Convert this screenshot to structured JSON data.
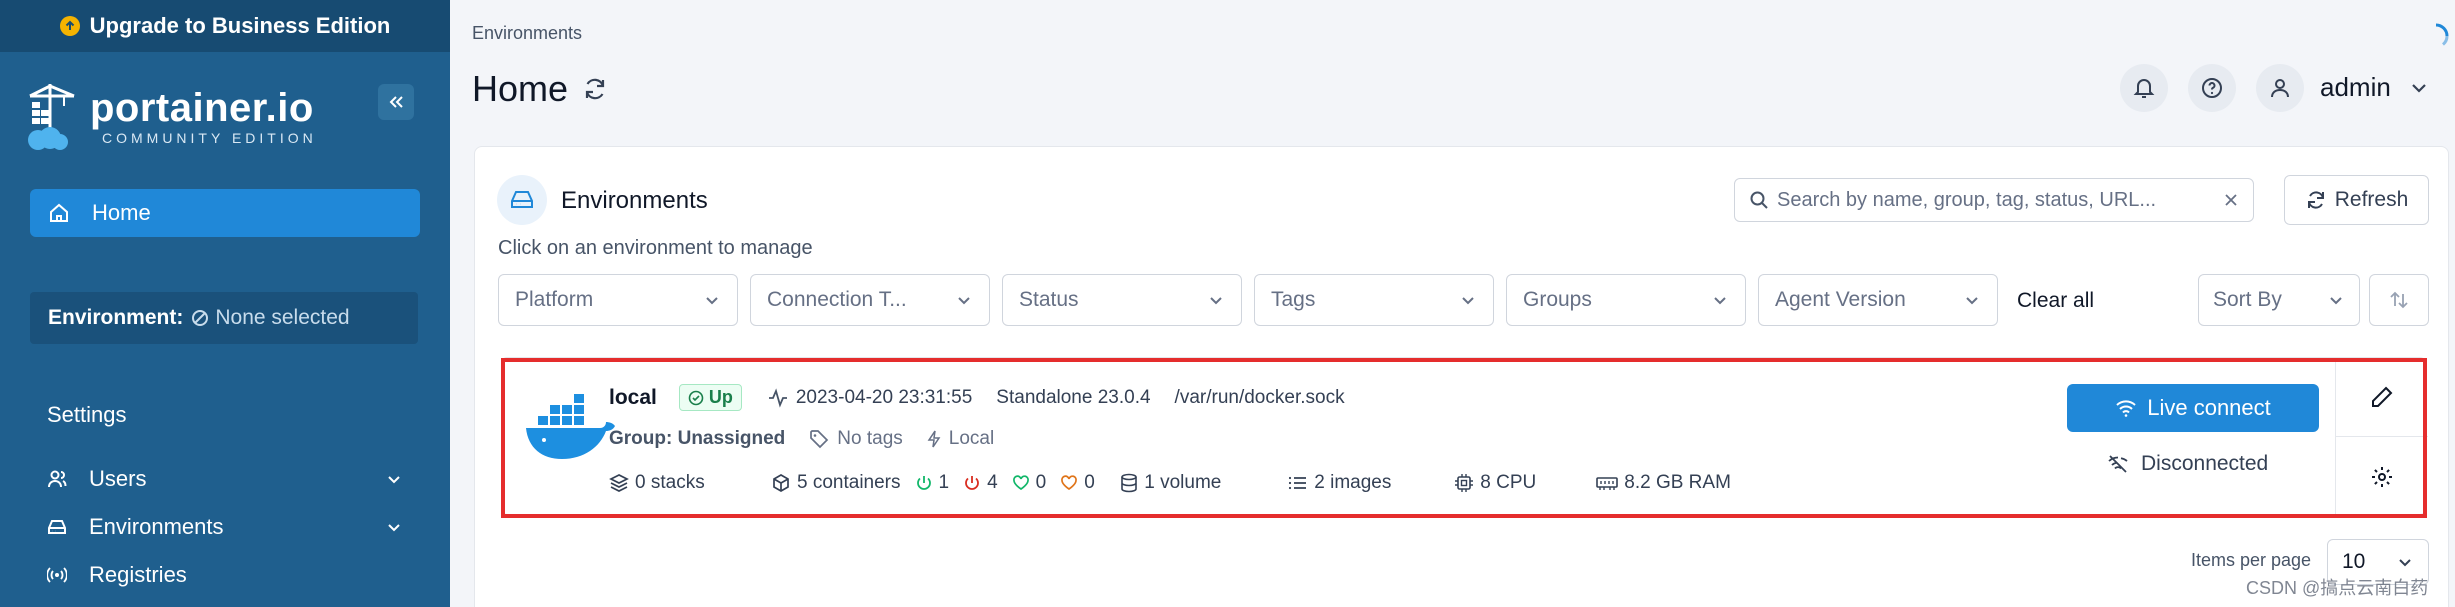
{
  "sidebar": {
    "upgrade_label": "Upgrade to Business Edition",
    "brand": "portainer.io",
    "edition": "COMMUNITY EDITION",
    "nav_home": "Home",
    "environment_label": "Environment:",
    "environment_value": "None selected",
    "settings_heading": "Settings",
    "items": [
      {
        "label": "Users",
        "icon": "users-icon"
      },
      {
        "label": "Environments",
        "icon": "hard-drive-icon"
      },
      {
        "label": "Registries",
        "icon": "radio-icon"
      }
    ]
  },
  "header": {
    "breadcrumb": "Environments",
    "title": "Home",
    "username": "admin"
  },
  "panel": {
    "title": "Environments",
    "subtitle": "Click on an environment to manage",
    "search_placeholder": "Search by name, group, tag, status, URL...",
    "refresh_label": "Refresh",
    "filters": [
      "Platform",
      "Connection T...",
      "Status",
      "Tags",
      "Groups",
      "Agent Version"
    ],
    "clear_all": "Clear all",
    "sort_by": "Sort By",
    "items_per_page_label": "Items per page",
    "items_per_page_value": "10"
  },
  "environment": {
    "name": "local",
    "status": "Up",
    "last_check": "2023-04-20 23:31:55",
    "type": "Standalone 23.0.4",
    "url": "/var/run/docker.sock",
    "group": "Group: Unassigned",
    "tags": "No tags",
    "connection": "Local",
    "stacks": "0 stacks",
    "containers": "5 containers",
    "running": "1",
    "stopped": "4",
    "healthy": "0",
    "unhealthy": "0",
    "volumes": "1 volume",
    "images": "2 images",
    "cpu": "8 CPU",
    "ram": "8.2 GB RAM",
    "live_connect": "Live connect",
    "connection_state": "Disconnected"
  },
  "watermark": "CSDN @搞点云南白药",
  "colors": {
    "sidebar_bg": "#1f5f8e",
    "accent": "#2088d8",
    "status_up": "#1a7f4b",
    "highlight": "#e52d2d"
  }
}
